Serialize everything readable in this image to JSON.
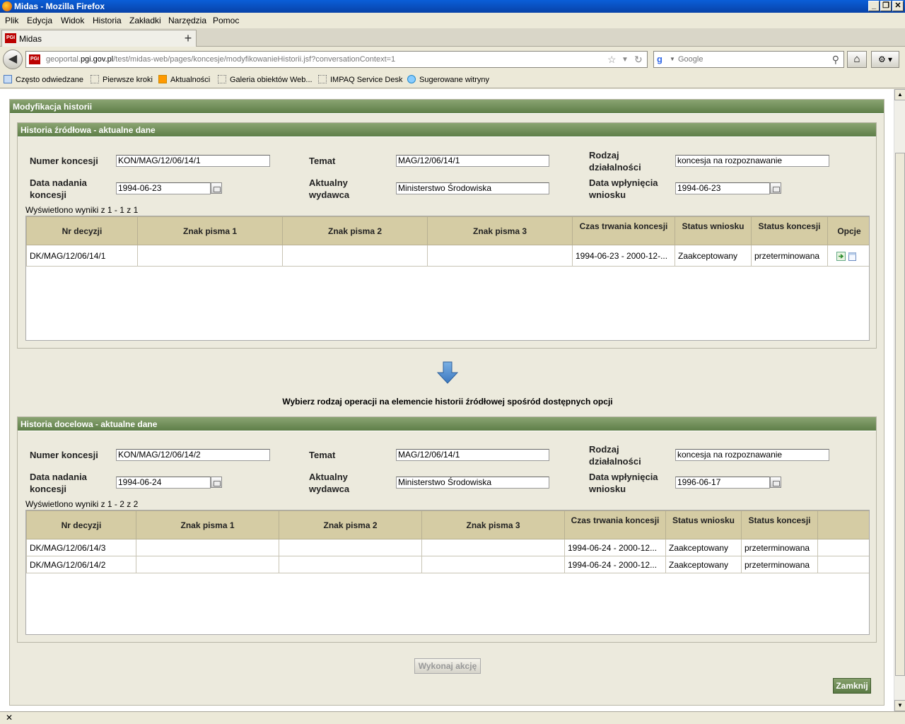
{
  "window": {
    "title": "Midas - Mozilla Firefox"
  },
  "menu": [
    "Plik",
    "Edycja",
    "Widok",
    "Historia",
    "Zakładki",
    "Narzędzia",
    "Pomoc"
  ],
  "tab": {
    "label": "Midas",
    "favicon": "PGI"
  },
  "nav": {
    "url_prefix": "geoportal.",
    "url_domain": "pgi.gov.pl",
    "url_path": "/test/midas-web/pages/koncesje/modyfikowanieHistorii.jsf?conversationContext=1",
    "search_placeholder": "Google"
  },
  "bookmarks": [
    "Często odwiedzane",
    "Pierwsze kroki",
    "Aktualności",
    "Galeria obiektów Web...",
    "IMPAQ Service Desk",
    "Sugerowane witryny"
  ],
  "main": {
    "title": "Modyfikacja historii",
    "instruction": "Wybierz rodzaj operacji na elemencie historii źródłowej spośród dostępnych opcji",
    "execute_label": "Wykonaj akcję",
    "close_label": "Zamknij"
  },
  "labels": {
    "numer_line1": "Numer koncesji",
    "temat": "Temat",
    "rodzaj_line1": "Rodzaj",
    "rodzaj_line2": "działalności",
    "data_nadania_line1": "Data nadania",
    "data_nadania_line2": "koncesji",
    "wydawca_line1": "Aktualny",
    "wydawca_line2": "wydawca",
    "wplyniecia_line1": "Data wpłynięcia",
    "wplyniecia_line2": "wniosku"
  },
  "source": {
    "title": "Historia źródłowa - aktualne dane",
    "numer": "KON/MAG/12/06/14/1",
    "temat": "MAG/12/06/14/1",
    "rodzaj": "koncesja na rozpoznawanie",
    "data_nadania": "1994-06-23",
    "wydawca": "Ministerstwo Środowiska",
    "data_wplyniecia": "1994-06-23",
    "count": "Wyświetlono wyniki z 1 - 1 z 1",
    "columns": [
      "Nr decyzji",
      "Znak pisma 1",
      "Znak pisma 2",
      "Znak pisma 3",
      "Czas trwania koncesji",
      "Status wniosku",
      "Status koncesji",
      "Opcje"
    ],
    "rows": [
      [
        "DK/MAG/12/06/14/1",
        "",
        "",
        "",
        "1994-06-23 - 2000-12-...",
        "Zaakceptowany",
        "przeterminowana"
      ]
    ]
  },
  "target": {
    "title": "Historia docelowa - aktualne dane",
    "numer": "KON/MAG/12/06/14/2",
    "temat": "MAG/12/06/14/1",
    "rodzaj": "koncesja na rozpoznawanie",
    "data_nadania": "1994-06-24",
    "wydawca": "Ministerstwo Środowiska",
    "data_wplyniecia": "1996-06-17",
    "count": "Wyświetlono wyniki z 1 - 2 z 2",
    "columns": [
      "Nr decyzji",
      "Znak pisma 1",
      "Znak pisma 2",
      "Znak pisma 3",
      "Czas trwania koncesji",
      "Status wniosku",
      "Status koncesji",
      ""
    ],
    "rows": [
      [
        "DK/MAG/12/06/14/3",
        "",
        "",
        "",
        "1994-06-24 - 2000-12...",
        "Zaakceptowany",
        "przeterminowana"
      ],
      [
        "DK/MAG/12/06/14/2",
        "",
        "",
        "",
        "1994-06-24 - 2000-12...",
        "Zaakceptowany",
        "przeterminowana"
      ]
    ]
  },
  "colors": {
    "header_green": "#6f8c57",
    "grid_header": "#d5cca4",
    "panel_bg": "#eceadd"
  }
}
